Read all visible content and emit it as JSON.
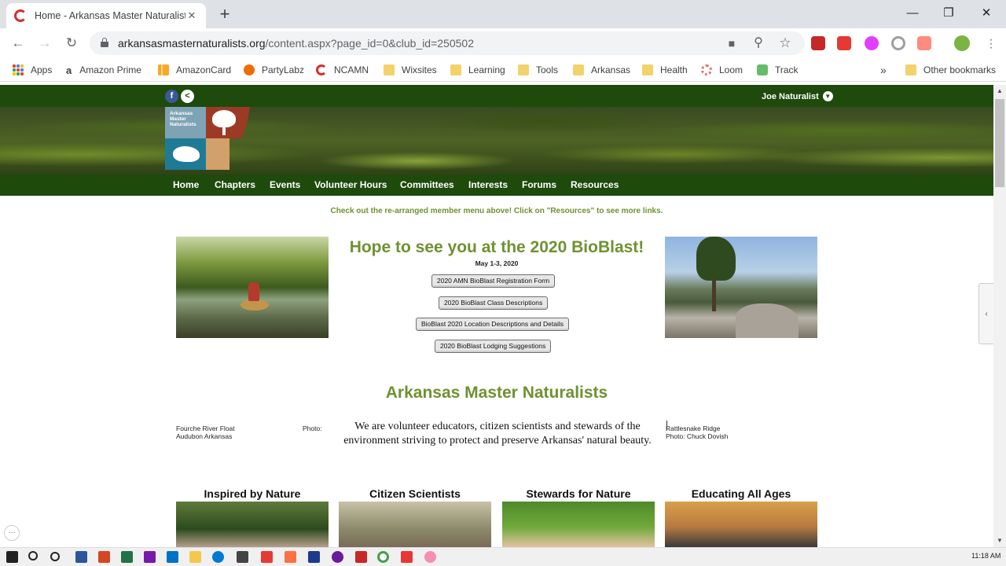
{
  "browser": {
    "tab_title": "Home - Arkansas Master Naturalists",
    "tab_close": "✕",
    "new_tab": "+",
    "window": {
      "minimize": "—",
      "maximize": "❐",
      "close": "✕"
    },
    "nav": {
      "back": "←",
      "forward": "→",
      "reload": "↻"
    },
    "url_host": "arkansasmasternaturalists.org",
    "url_path": "/content.aspx?page_id=0&club_id=250502",
    "omnibox_icons": [
      "camera-icon",
      "zoom-icon",
      "star-icon"
    ],
    "glyphs": {
      "camera": "■",
      "zoom": "⚲",
      "star": "☆"
    }
  },
  "bookmarks": [
    {
      "label": "Apps",
      "icon": "apps-grid-icon"
    },
    {
      "label": "Amazon Prime",
      "icon": "amazon-icon"
    },
    {
      "label": "AmazonCard",
      "icon": "chart-icon"
    },
    {
      "label": "PartyLabz",
      "icon": "party-icon"
    },
    {
      "label": "NCAMN",
      "icon": "ncamn-icon"
    },
    {
      "label": "Wixsites",
      "icon": "folder-icon"
    },
    {
      "label": "Learning",
      "icon": "folder-icon"
    },
    {
      "label": "Tools",
      "icon": "folder-icon"
    },
    {
      "label": "Arkansas",
      "icon": "folder-icon"
    },
    {
      "label": "Health",
      "icon": "folder-icon"
    },
    {
      "label": "Loom",
      "icon": "loom-icon"
    },
    {
      "label": "Track",
      "icon": "track-icon"
    }
  ],
  "bookmarks_overflow": "»",
  "other_bookmarks": "Other bookmarks",
  "site": {
    "user_menu": "Joe Naturalist",
    "user_caret": "▼",
    "social": {
      "facebook": "f",
      "share": "<"
    },
    "logo_text": "Arkansas Master Naturalists",
    "nav": [
      "Home",
      "Chapters",
      "Events",
      "Volunteer Hours",
      "Committees",
      "Interests",
      "Forums",
      "Resources"
    ],
    "notice": "Check out the re-arranged member menu above!  Click on \"Resources\" to see more links.",
    "headline": "Hope to see you at the 2020 BioBlast!",
    "dates": "May 1-3, 2020",
    "buttons": [
      "2020 AMN BioBlast Registration Form",
      "2020 BioBlast Class Descriptions",
      "BioBlast 2020 Location Descriptions and Details",
      "2020 BioBlast Lodging Suggestions"
    ],
    "left_caption_1": "Fourche River Float",
    "left_caption_photo": "Photo:",
    "left_caption_2": "Audubon Arkansas",
    "right_caption_1": "Rattlesnake Ridge",
    "right_caption_2": "Photo: Chuck Dovish",
    "title": "Arkansas Master Naturalists",
    "mission": "We are volunteer educators, citizen scientists and stewards of the environment striving to protect and preserve Arkansas' natural beauty.",
    "columns": [
      "Inspired by Nature",
      "Citizen Scientists",
      "Stewards for Nature",
      "Educating All Ages"
    ]
  },
  "ui": {
    "side_tab": "‹",
    "dots": "···",
    "scroll_up": "▲",
    "scroll_down": "▼"
  },
  "taskbar": {
    "time": "11:18 AM"
  }
}
